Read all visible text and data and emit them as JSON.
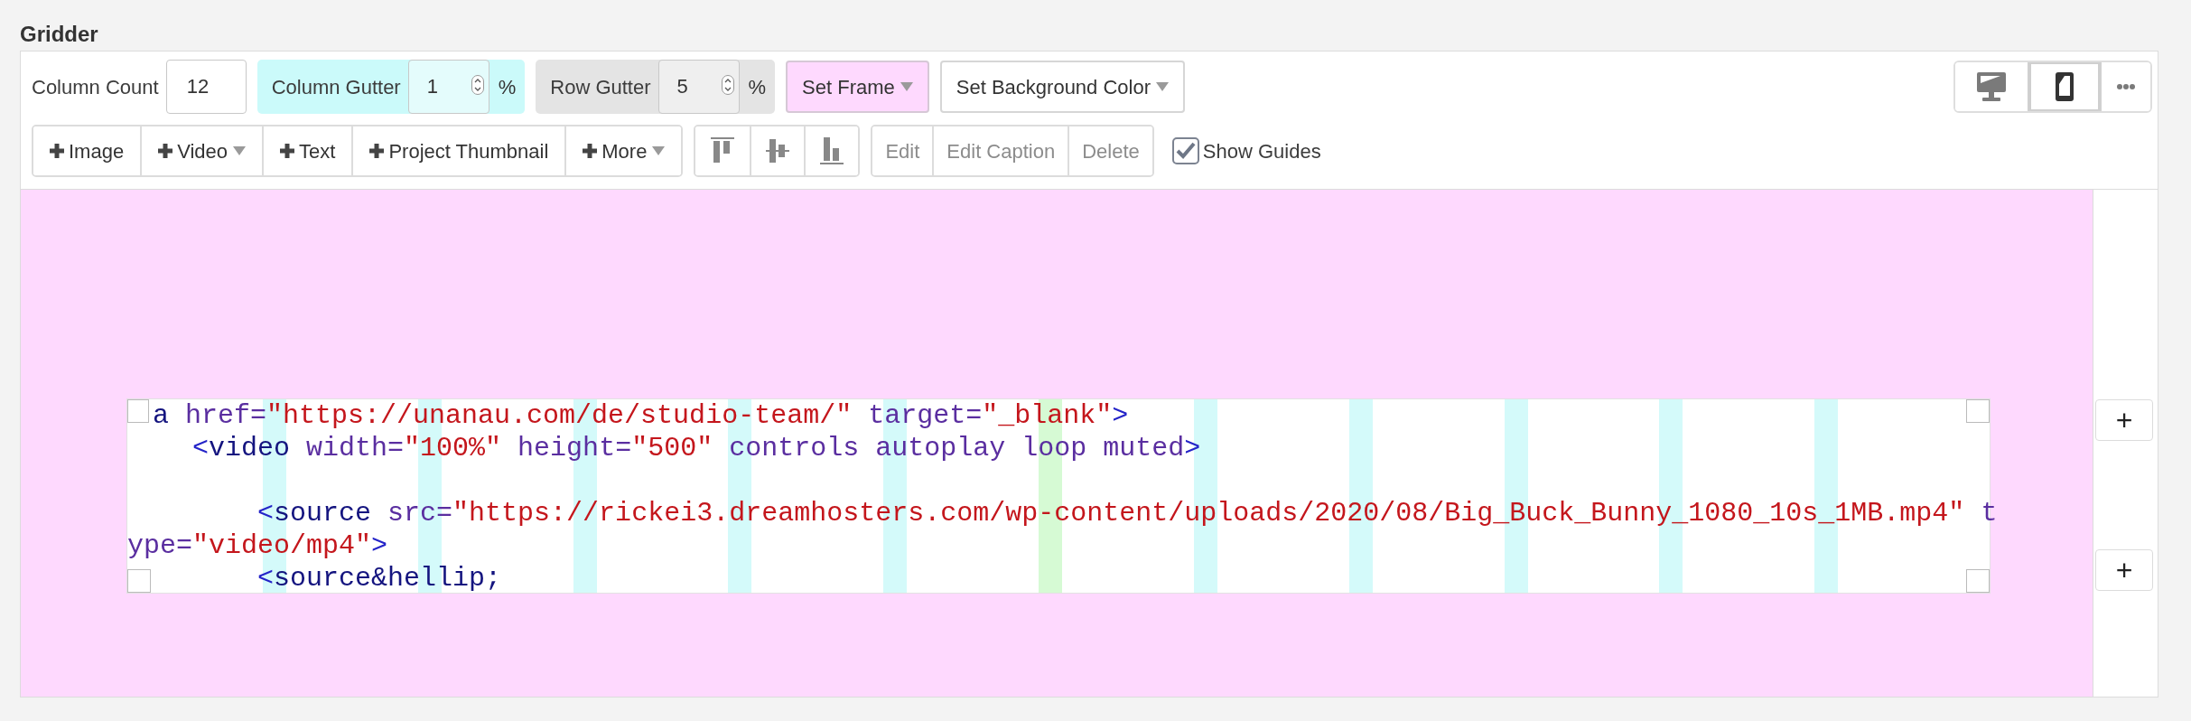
{
  "section_title": "Gridder",
  "toolbar": {
    "column_count": {
      "label": "Column Count",
      "value": "12"
    },
    "column_gutter": {
      "label": "Column Gutter",
      "value": "1",
      "unit": "%"
    },
    "row_gutter": {
      "label": "Row Gutter",
      "value": "5",
      "unit": "%"
    },
    "set_frame": {
      "label": "Set Frame"
    },
    "set_background": {
      "label": "Set Background Color"
    },
    "views": [
      {
        "kind": "desktop",
        "selected": false
      },
      {
        "kind": "mobile",
        "selected": true
      },
      {
        "kind": "more",
        "selected": false
      }
    ]
  },
  "add_buttons": [
    {
      "label": "Image",
      "dropdown": false
    },
    {
      "label": "Video",
      "dropdown": true
    },
    {
      "label": "Text",
      "dropdown": false
    },
    {
      "label": "Project Thumbnail",
      "dropdown": false
    },
    {
      "label": "More",
      "dropdown": true
    }
  ],
  "align_buttons": [
    {
      "kind": "top"
    },
    {
      "kind": "middle"
    },
    {
      "kind": "bottom"
    }
  ],
  "edit_buttons": [
    {
      "label": "Edit",
      "disabled": true
    },
    {
      "label": "Edit Caption",
      "disabled": true
    },
    {
      "label": "Delete",
      "disabled": true
    }
  ],
  "show_guides": {
    "label": "Show Guides",
    "checked": true
  },
  "guides": [
    {
      "color": "#d4fafa"
    },
    {
      "color": "#d4fafa"
    },
    {
      "color": "#d4fafa"
    },
    {
      "color": "#d4fafa"
    },
    {
      "color": "#d4fafa"
    },
    {
      "color": "#d6fad4"
    },
    {
      "color": "#d4fafa"
    },
    {
      "color": "#d4fafa"
    },
    {
      "color": "#d4fafa"
    },
    {
      "color": "#d4fafa"
    },
    {
      "color": "#d4fafa"
    }
  ],
  "code_lines": [
    {
      "kind": "code",
      "tokens": [
        {
          "kind": "tag",
          "text": "a"
        },
        {
          "kind": "attr",
          "text": " href="
        },
        {
          "kind": "string",
          "text": "\"https://unanau.com/de/studio-team/\""
        },
        {
          "kind": "attr",
          "text": " target="
        },
        {
          "kind": "string",
          "text": "\"_blank\""
        },
        {
          "kind": "bracket",
          "text": ">"
        }
      ]
    },
    {
      "kind": "code",
      "tokens": [
        {
          "kind": "bracket",
          "text": "    <"
        },
        {
          "kind": "tag",
          "text": "video"
        },
        {
          "kind": "attr",
          "text": " width="
        },
        {
          "kind": "string",
          "text": "\"100%\""
        },
        {
          "kind": "attr",
          "text": " height="
        },
        {
          "kind": "string",
          "text": "\"500\""
        },
        {
          "kind": "attr",
          "text": " controls autoplay loop muted"
        },
        {
          "kind": "bracket",
          "text": ">"
        }
      ]
    },
    {
      "kind": "blank"
    },
    {
      "kind": "code",
      "tokens": [
        {
          "kind": "bracket",
          "text": "        <"
        },
        {
          "kind": "tag",
          "text": "source"
        },
        {
          "kind": "attr",
          "text": " src="
        },
        {
          "kind": "string",
          "text": "\"https://rickei3.dreamhosters.com/wp-content/uploads/2020/08/Big_Buck_Bunny_1080_10s_1MB.mp4\""
        },
        {
          "kind": "attr",
          "text": " t"
        }
      ]
    },
    {
      "kind": "code",
      "tokens": [
        {
          "kind": "attr",
          "text": "ype="
        },
        {
          "kind": "string",
          "text": "\"video/mp4\""
        },
        {
          "kind": "bracket",
          "text": ">"
        }
      ]
    },
    {
      "kind": "code",
      "tokens": [
        {
          "kind": "bracket",
          "text": "        <"
        },
        {
          "kind": "tag",
          "text": "source&hellip;"
        }
      ]
    }
  ],
  "corner_checkboxes": [
    {
      "checked": false
    },
    {
      "checked": false
    },
    {
      "checked": false
    },
    {
      "checked": false
    }
  ],
  "row_add_buttons": [
    "+",
    "+"
  ]
}
